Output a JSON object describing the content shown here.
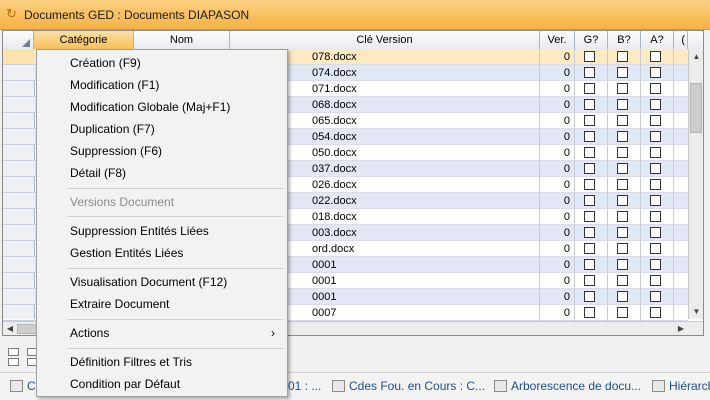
{
  "window": {
    "title": "Documents GED : Documents DIAPASON"
  },
  "grid": {
    "columns": [
      "Catégorie",
      "Nom",
      "Clé Version",
      "Ver.",
      "G?",
      "B?",
      "A?",
      "("
    ],
    "rows": [
      {
        "cle": "078.docx",
        "ver": "0"
      },
      {
        "cle": "074.docx",
        "ver": "0"
      },
      {
        "cle": "071.docx",
        "ver": "0"
      },
      {
        "cle": "068.docx",
        "ver": "0"
      },
      {
        "cle": "065.docx",
        "ver": "0"
      },
      {
        "cle": "054.docx",
        "ver": "0"
      },
      {
        "cle": "050.docx",
        "ver": "0"
      },
      {
        "cle": "037.docx",
        "ver": "0"
      },
      {
        "cle": "026.docx",
        "ver": "0"
      },
      {
        "cle": "022.docx",
        "ver": "0"
      },
      {
        "cle": "018.docx",
        "ver": "0"
      },
      {
        "cle": "003.docx",
        "ver": "0"
      },
      {
        "cle": "ord.docx",
        "ver": "0"
      },
      {
        "cle": "0001",
        "ver": "0"
      },
      {
        "cle": "0001",
        "ver": "0"
      },
      {
        "cle": "0001",
        "ver": "0"
      },
      {
        "cle": "0007",
        "ver": "0"
      }
    ]
  },
  "context_menu": {
    "items": [
      "Création (F9)",
      "Modification (F1)",
      "Modification Globale (Maj+F1)",
      "Duplication (F7)",
      "Suppression (F6)",
      "Détail (F8)",
      "Versions Document",
      "Suppression Entités Liées",
      "Gestion Entités Liées",
      "Visualisation Document (F12)",
      "Extraire Document",
      "Actions",
      "Définition Filtres et Tris",
      "Condition par Défaut"
    ],
    "submenu_arrow": "›"
  },
  "taskbar": {
    "items": [
      "C",
      "01 : ...",
      "Cdes Fou. en Cours : C...",
      "Arborescence de docu...",
      "Hiérarch"
    ]
  },
  "icons": {
    "app": "refresh-icon",
    "scroll_up": "▲",
    "scroll_down": "▼",
    "scroll_left": "◀",
    "scroll_right": "▶"
  },
  "colors": {
    "titlebar": "#f6b243",
    "row_alt": "#dfe8f4",
    "selected_row": "#fde9c2"
  }
}
